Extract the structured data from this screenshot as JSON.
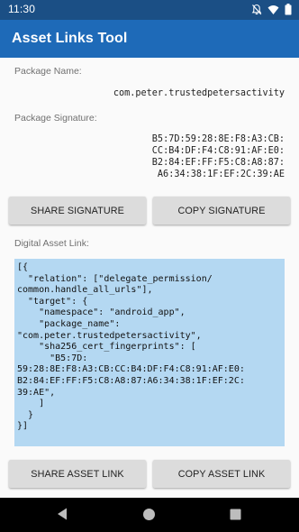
{
  "status_bar": {
    "time": "11:30"
  },
  "app_bar": {
    "title": "Asset Links Tool"
  },
  "package": {
    "name_label": "Package Name:",
    "name_value": "com.peter.trustedpetersactivity",
    "signature_label": "Package Signature:",
    "signature_value": "B5:7D:59:28:8E:F8:A3:CB:\nCC:B4:DF:F4:C8:91:AF:E0:\nB2:84:EF:FF:F5:C8:A8:87:\nA6:34:38:1F:EF:2C:39:AE"
  },
  "buttons": {
    "share_signature": "SHARE SIGNATURE",
    "copy_signature": "COPY SIGNATURE",
    "share_asset_link": "SHARE ASSET LINK",
    "copy_asset_link": "COPY ASSET LINK"
  },
  "asset_link": {
    "label": "Digital Asset Link:",
    "json_text": "[{\n  \"relation\": [\"delegate_permission/\ncommon.handle_all_urls\"],\n  \"target\": {\n    \"namespace\": \"android_app\",\n    \"package_name\":\n\"com.peter.trustedpetersactivity\",\n    \"sha256_cert_fingerprints\": [\n      \"B5:7D:\n59:28:8E:F8:A3:CB:CC:B4:DF:F4:C8:91:AF:E0:\nB2:84:EF:FF:F5:C8:A8:87:A6:34:38:1F:EF:2C:\n39:AE\",\n    ]\n  }\n}]"
  },
  "icons": {
    "status": [
      "notifications-off-icon",
      "wifi-icon",
      "battery-icon"
    ],
    "nav": [
      "back-icon",
      "home-icon",
      "recents-icon"
    ]
  }
}
